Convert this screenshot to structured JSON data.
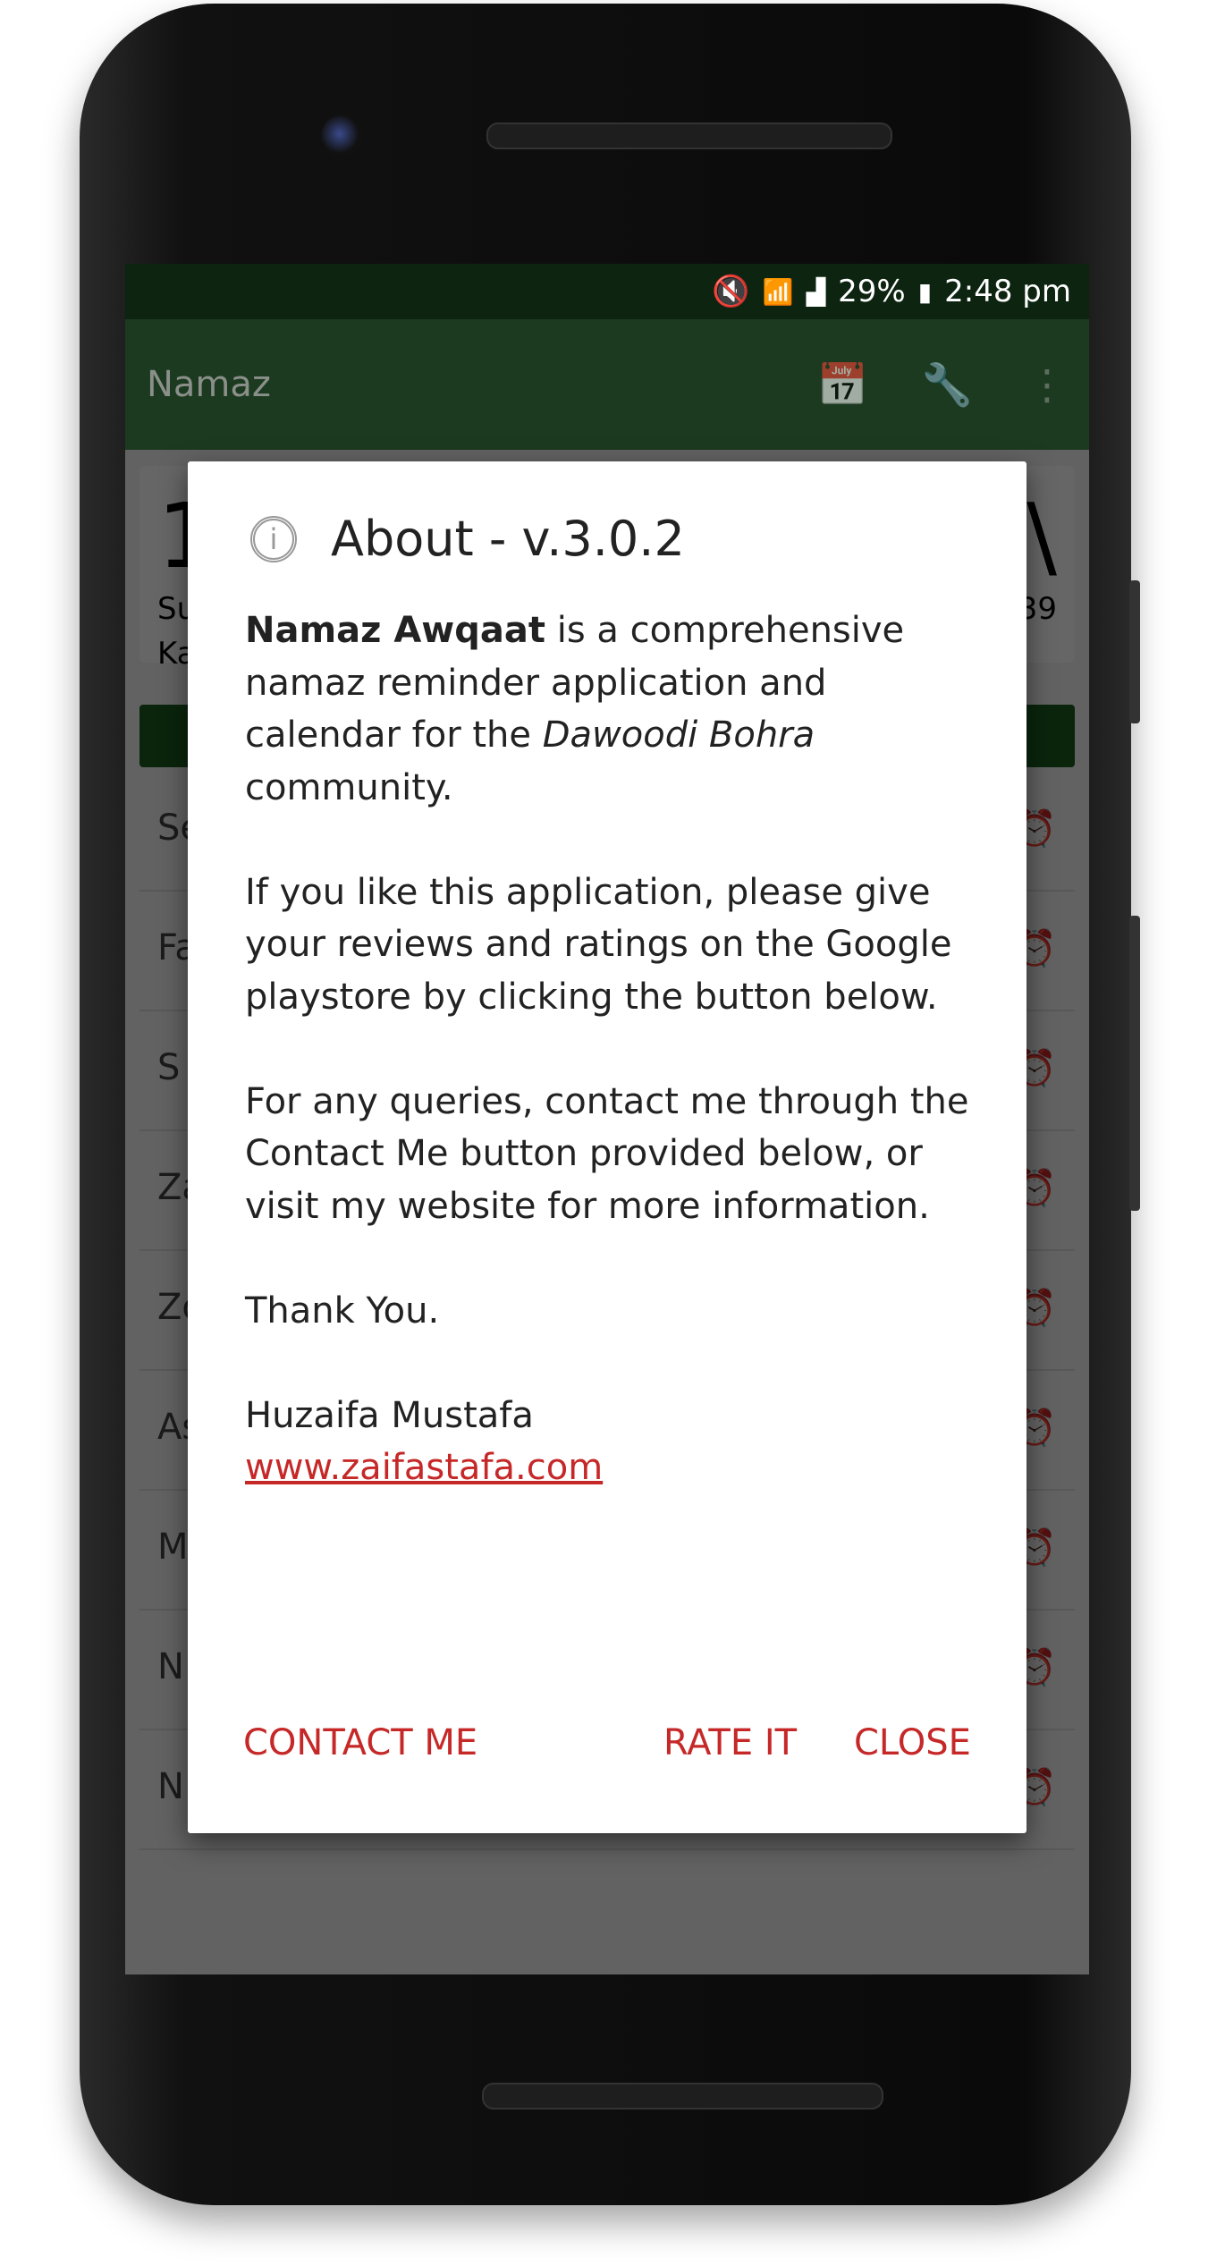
{
  "status_bar": {
    "battery": "29%",
    "time": "2:48 pm",
    "icons": [
      "mute-icon",
      "wifi-icon",
      "signal-icon",
      "battery-charging-icon"
    ]
  },
  "toolbar": {
    "title": "Namaz",
    "icons": [
      "calendar-contact-icon",
      "wrench-icon",
      "more-vert-icon"
    ]
  },
  "background": {
    "card": {
      "big_left": "1",
      "line1": "Su",
      "line2": "Ka",
      "big_right": "\\",
      "right_line": "39"
    },
    "rows": [
      {
        "label": "Se"
      },
      {
        "label": "Fa"
      },
      {
        "label": "S"
      },
      {
        "label": "Za"
      },
      {
        "label": "Zo"
      },
      {
        "label": "As"
      },
      {
        "label": "M"
      },
      {
        "label": "N"
      },
      {
        "label": "N"
      }
    ]
  },
  "dialog": {
    "title": "About - v.3.0.2",
    "intro_bold": "Namaz Awqaat",
    "intro_rest": " is a comprehensive namaz reminder application and calendar for the ",
    "intro_italic": "Dawoodi Bohra",
    "intro_end": " community.",
    "para2": "If you like this application, please give your reviews and ratings on the Google playstore by clicking the button below.",
    "para3": "For any queries, contact me through the Contact Me button provided below, or visit my website for more information.",
    "thanks": "Thank You.",
    "author": "Huzaifa Mustafa",
    "website": "www.zaifastafa.com",
    "buttons": {
      "contact": "CONTACT ME",
      "rate": "RATE IT",
      "close": "CLOSE"
    }
  },
  "colors": {
    "primary": "#2e7d32",
    "primary_dark": "#1b5e20",
    "accent": "#c62828"
  }
}
